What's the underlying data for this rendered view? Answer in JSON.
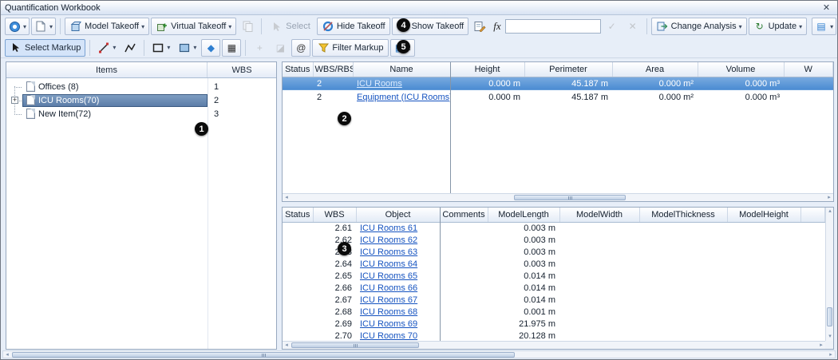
{
  "window": {
    "title": "Quantification Workbook",
    "close_glyph": "✕"
  },
  "icons": {
    "dropdown_glyph": "▾",
    "fx_glyph": "fx",
    "check_glyph": "✓",
    "cancel_glyph": "✕",
    "update_glyph": "↻",
    "export_glyph": "▤",
    "bucket_glyph": "◆",
    "hatch_glyph": "▦",
    "eraser_glyph": "◪",
    "add_vertex_glyph": "+",
    "circle_markup_glyph": "@",
    "pencil_glyph": "✎",
    "expander_glyph": "+",
    "scroll_left_glyph": "◂",
    "scroll_right_glyph": "▸",
    "scroll_up_glyph": "▴",
    "scroll_down_glyph": "▾"
  },
  "toolbar_main": {
    "model_takeoff_label": "Model Takeoff",
    "virtual_takeoff_label": "Virtual Takeoff",
    "select_label": "Select",
    "hide_takeoff_label": "Hide Takeoff",
    "show_takeoff_label": "Show Takeoff",
    "formula_value": "",
    "change_analysis_label": "Change Analysis",
    "update_label": "Update"
  },
  "toolbar_markup": {
    "select_markup_label": "Select Markup",
    "filter_markup_label": "Filter Markup"
  },
  "annotations": {
    "n1": "1",
    "n2": "2",
    "n3": "3",
    "n4": "4",
    "n5": "5"
  },
  "tree_panel": {
    "header": {
      "items": "Items",
      "wbs": "WBS"
    },
    "items": [
      {
        "label": "Offices (8)",
        "wbs": "1",
        "selected": false,
        "expandable": false
      },
      {
        "label": "ICU Rooms(70)",
        "wbs": "2",
        "selected": true,
        "expandable": true
      },
      {
        "label": "New Item(72)",
        "wbs": "3",
        "selected": false,
        "expandable": false
      }
    ]
  },
  "takeoff_table": {
    "columns": [
      "Status",
      "WBS/RBS",
      "Name",
      "Height",
      "Perimeter",
      "Area",
      "Volume",
      "W"
    ],
    "rows": [
      {
        "status": "",
        "wbs_rbs": "2",
        "name": "ICU Rooms",
        "height": "0.000 m",
        "perimeter": "45.187 m",
        "area": "0.000 m²",
        "volume": "0.000 m³",
        "selected": true
      },
      {
        "status": "",
        "wbs_rbs": "2",
        "name": "Equipment (ICU Rooms)",
        "height": "0.000 m",
        "perimeter": "45.187 m",
        "area": "0.000 m²",
        "volume": "0.000 m³",
        "selected": false
      }
    ]
  },
  "object_table": {
    "columns": [
      "Status",
      "WBS",
      "Object",
      "Comments",
      "ModelLength",
      "ModelWidth",
      "ModelThickness",
      "ModelHeight"
    ],
    "rows": [
      {
        "status": "",
        "wbs": "2.61",
        "object": "ICU Rooms 61",
        "comments": "",
        "model_length": "0.003 m",
        "model_width": "",
        "model_thickness": "",
        "model_height": ""
      },
      {
        "status": "",
        "wbs": "2.62",
        "object": "ICU Rooms 62",
        "comments": "",
        "model_length": "0.003 m",
        "model_width": "",
        "model_thickness": "",
        "model_height": ""
      },
      {
        "status": "",
        "wbs": "2.63",
        "object": "ICU Rooms 63",
        "comments": "",
        "model_length": "0.003 m",
        "model_width": "",
        "model_thickness": "",
        "model_height": ""
      },
      {
        "status": "",
        "wbs": "2.64",
        "object": "ICU Rooms 64",
        "comments": "",
        "model_length": "0.003 m",
        "model_width": "",
        "model_thickness": "",
        "model_height": ""
      },
      {
        "status": "",
        "wbs": "2.65",
        "object": "ICU Rooms 65",
        "comments": "",
        "model_length": "0.014 m",
        "model_width": "",
        "model_thickness": "",
        "model_height": ""
      },
      {
        "status": "",
        "wbs": "2.66",
        "object": "ICU Rooms 66",
        "comments": "",
        "model_length": "0.014 m",
        "model_width": "",
        "model_thickness": "",
        "model_height": ""
      },
      {
        "status": "",
        "wbs": "2.67",
        "object": "ICU Rooms 67",
        "comments": "",
        "model_length": "0.014 m",
        "model_width": "",
        "model_thickness": "",
        "model_height": ""
      },
      {
        "status": "",
        "wbs": "2.68",
        "object": "ICU Rooms 68",
        "comments": "",
        "model_length": "0.001 m",
        "model_width": "",
        "model_thickness": "",
        "model_height": ""
      },
      {
        "status": "",
        "wbs": "2.69",
        "object": "ICU Rooms 69",
        "comments": "",
        "model_length": "21.975 m",
        "model_width": "",
        "model_thickness": "",
        "model_height": ""
      },
      {
        "status": "",
        "wbs": "2.70",
        "object": "ICU Rooms 70",
        "comments": "",
        "model_length": "20.128 m",
        "model_width": "",
        "model_thickness": "",
        "model_height": ""
      }
    ]
  },
  "colors": {
    "selection_row": "#4a8bd2",
    "tree_selection": "#5c7da8",
    "link": "#1553c0",
    "annotation_bg": "#0b0b0b"
  }
}
